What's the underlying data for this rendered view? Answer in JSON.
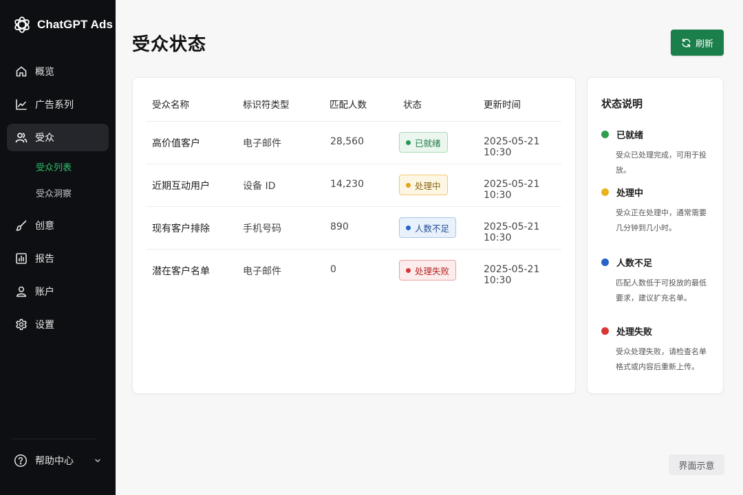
{
  "app": {
    "name": "ChatGPT Ads"
  },
  "sidebar": {
    "items": [
      {
        "label": "概览",
        "icon": "home-icon"
      },
      {
        "label": "广告系列",
        "icon": "chart-line-icon"
      },
      {
        "label": "受众",
        "icon": "users-icon",
        "active": true
      },
      {
        "label": "创意",
        "icon": "brush-icon"
      },
      {
        "label": "报告",
        "icon": "bar-chart-icon"
      },
      {
        "label": "账户",
        "icon": "user-icon"
      },
      {
        "label": "设置",
        "icon": "gear-icon"
      }
    ],
    "subitems": [
      {
        "label": "受众列表",
        "active": true
      },
      {
        "label": "受众洞察"
      }
    ],
    "help": {
      "label": "帮助中心",
      "icon": "question-circle-icon"
    }
  },
  "header": {
    "title": "受众状态",
    "refresh_label": "刷新",
    "refresh_icon": "refresh-icon"
  },
  "table": {
    "columns": [
      "受众名称",
      "标识符类型",
      "匹配人数",
      "状态",
      "更新时间"
    ],
    "rows": [
      {
        "name": "高价值客户",
        "id_type": "电子邮件",
        "count": "28,560",
        "status": "已就绪",
        "status_key": "ready",
        "updated": "2025-05-21 10:30"
      },
      {
        "name": "近期互动用户",
        "id_type": "设备 ID",
        "count": "14,230",
        "status": "处理中",
        "status_key": "processing",
        "updated": "2025-05-21 10:30"
      },
      {
        "name": "现有客户排除",
        "id_type": "手机号码",
        "count": "890",
        "status": "人数不足",
        "status_key": "insufficient",
        "updated": "2025-05-21 10:30"
      },
      {
        "name": "潜在客户名单",
        "id_type": "电子邮件",
        "count": "0",
        "status": "处理失败",
        "status_key": "failed",
        "updated": "2025-05-21 10:30"
      }
    ]
  },
  "legend": {
    "title": "状态说明",
    "items": [
      {
        "label": "已就绪",
        "color": "#2f9e4f",
        "desc": "受众已处理完成，可用于投放。"
      },
      {
        "label": "处理中",
        "color": "#e9b21c",
        "desc": "受众正在处理中，通常需要\n几分钟到几小时。"
      },
      {
        "label": "人数不足",
        "color": "#2563c9",
        "desc": "匹配人数低于可投放的最低\n要求，建议扩充名单。"
      },
      {
        "label": "处理失败",
        "color": "#d93636",
        "desc": "受众处理失败，请检查名单\n格式或内容后重新上传。"
      }
    ]
  },
  "footer": {
    "demo_label": "界面示意"
  },
  "colors": {
    "sidebar_bg": "#0e0f12",
    "accent_green": "#1a7f4b",
    "active_sub": "#29c26a"
  }
}
